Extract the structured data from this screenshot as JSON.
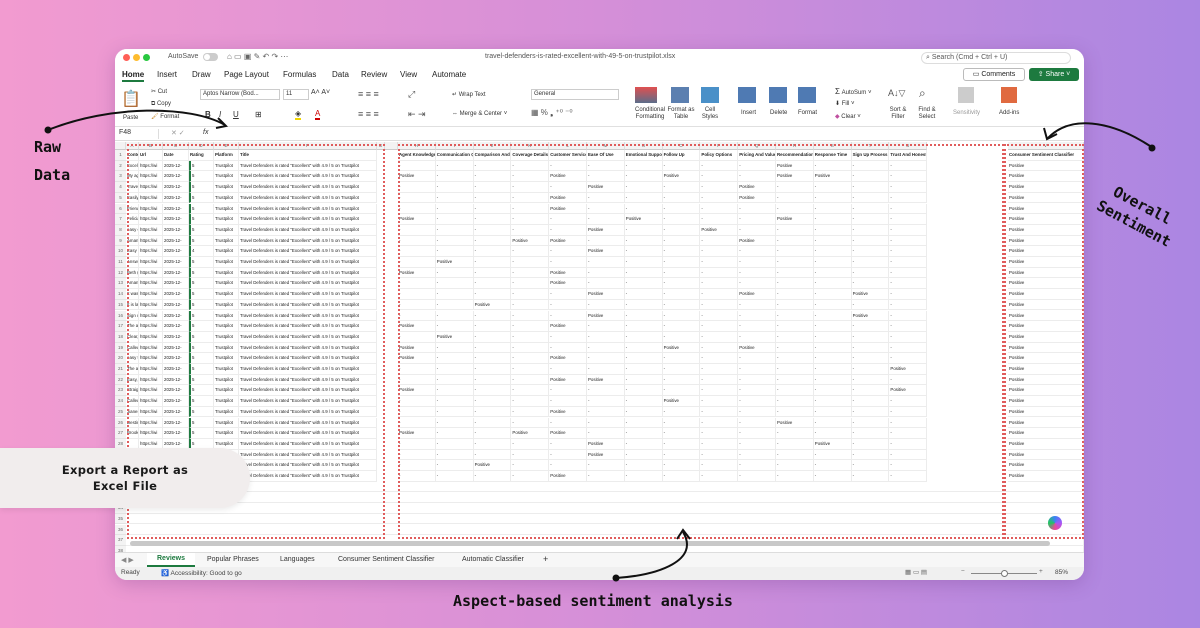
{
  "window": {
    "autosave_label": "AutoSave",
    "filename": "travel-defenders-is-rated-excellent-with-49-5-on-trustpilot.xlsx",
    "search_placeholder": "Search (Cmd + Ctrl + U)"
  },
  "menu": {
    "tabs": [
      "Home",
      "Insert",
      "Draw",
      "Page Layout",
      "Formulas",
      "Data",
      "Review",
      "View",
      "Automate"
    ],
    "comments_label": "Comments",
    "share_label": "Share"
  },
  "ribbon": {
    "paste": "Paste",
    "cut": "Cut",
    "copy": "Copy",
    "format": "Format",
    "font_name": "Aptos Narrow (Bod...",
    "font_size": "11",
    "wrap_text": "Wrap Text",
    "merge_center": "Merge & Center",
    "number_format": "General",
    "conditional_formatting": "Conditional Formatting",
    "format_as_table": "Format as Table",
    "cell_styles": "Cell Styles",
    "insert": "Insert",
    "delete": "Delete",
    "format_cells": "Format",
    "autosum": "AutoSum",
    "fill": "Fill",
    "clear": "Clear",
    "sort_filter": "Sort & Filter",
    "find_select": "Find & Select",
    "sensitivity": "Sensitivity",
    "addins": "Add-ins"
  },
  "formula_bar": {
    "cell_ref": "F48",
    "fx": "fx"
  },
  "grid": {
    "col_letters": [
      "A",
      "B",
      "C",
      "D",
      "E",
      "F",
      "G",
      "H",
      "I",
      "J",
      "K",
      "L",
      "M",
      "N",
      "O",
      "P",
      "Q",
      "R",
      "S",
      "T",
      "U",
      "V"
    ],
    "headers_left": [
      "Content",
      "Url",
      "Date",
      "Rating",
      "Platform",
      "Title"
    ],
    "headers_aspect": [
      "Agent Knowledge",
      "Communication Quality",
      "Comparison And Clarity",
      "Coverage Details",
      "Customer Service",
      "Ease Of Use",
      "Emotional Support",
      "Follow Up",
      "Policy Options",
      "Pricing And Value",
      "Recommendation",
      "Response Time",
      "Sign Up Process",
      "Trust And Honesty"
    ],
    "header_overall": "Consumer Sentiment Classifier",
    "content_snippets": [
      "Excellent",
      "My agent v",
      "Travel Def",
      "Easily fou",
      "Friendly h",
      "Felicia wa",
      "easy comp",
      "Amanda w",
      "Easy and",
      "Answered",
      "Beth (and",
      "Amanda w",
      "It was eas",
      "It is laid o",
      "Sign up c",
      "The agent",
      "Clear, con",
      "Called to l",
      "easy to d",
      "The agent",
      "Easy, free",
      "Straight fo",
      "Called me",
      "Jianessa v",
      "Destiny w",
      "Brooke w",
      "",
      "",
      ""
    ],
    "url_snippet": "https://wi",
    "date_snippet": "2025-12-",
    "rating": "5",
    "rating_alt": "4",
    "platform": "Trustpilot",
    "title_text": "Travel Defenders is rated \"Excellent\" with 4.9 / 5 on Trustpilot",
    "positive": "Positive",
    "dash": "-",
    "aspect_rows": [
      [
        0,
        0,
        0,
        0,
        0,
        0,
        0,
        0,
        0,
        0,
        1,
        0,
        0,
        0
      ],
      [
        1,
        0,
        0,
        0,
        1,
        0,
        0,
        1,
        0,
        0,
        1,
        1,
        0,
        0
      ],
      [
        0,
        0,
        0,
        0,
        0,
        1,
        0,
        0,
        0,
        1,
        0,
        0,
        0,
        0
      ],
      [
        0,
        0,
        0,
        0,
        1,
        0,
        0,
        0,
        0,
        1,
        0,
        0,
        0,
        0
      ],
      [
        0,
        0,
        0,
        0,
        1,
        0,
        0,
        0,
        0,
        0,
        0,
        0,
        0,
        0
      ],
      [
        1,
        0,
        0,
        0,
        0,
        0,
        1,
        0,
        0,
        0,
        1,
        0,
        0,
        0
      ],
      [
        0,
        0,
        0,
        0,
        0,
        1,
        0,
        0,
        1,
        0,
        0,
        0,
        0,
        0
      ],
      [
        0,
        0,
        0,
        1,
        1,
        0,
        0,
        0,
        0,
        1,
        0,
        0,
        0,
        0
      ],
      [
        0,
        0,
        0,
        0,
        0,
        1,
        0,
        0,
        0,
        0,
        0,
        0,
        0,
        0
      ],
      [
        0,
        1,
        0,
        0,
        0,
        0,
        0,
        0,
        0,
        0,
        0,
        0,
        0,
        0
      ],
      [
        1,
        0,
        0,
        0,
        1,
        0,
        0,
        0,
        0,
        0,
        0,
        0,
        0,
        0
      ],
      [
        0,
        0,
        0,
        0,
        1,
        0,
        0,
        0,
        0,
        0,
        0,
        0,
        0,
        0
      ],
      [
        0,
        0,
        0,
        0,
        0,
        1,
        0,
        0,
        0,
        1,
        0,
        0,
        1,
        0
      ],
      [
        0,
        0,
        1,
        0,
        0,
        0,
        0,
        0,
        0,
        0,
        0,
        0,
        0,
        0
      ],
      [
        0,
        0,
        0,
        0,
        0,
        1,
        0,
        0,
        0,
        0,
        0,
        0,
        1,
        0
      ],
      [
        1,
        0,
        0,
        0,
        1,
        0,
        0,
        0,
        0,
        0,
        0,
        0,
        0,
        0
      ],
      [
        0,
        1,
        0,
        0,
        0,
        0,
        0,
        0,
        0,
        0,
        0,
        0,
        0,
        0
      ],
      [
        1,
        0,
        0,
        0,
        0,
        0,
        0,
        1,
        0,
        1,
        0,
        0,
        0,
        0
      ],
      [
        1,
        0,
        0,
        0,
        1,
        0,
        0,
        0,
        0,
        0,
        0,
        0,
        0,
        0
      ],
      [
        0,
        0,
        0,
        0,
        0,
        0,
        0,
        0,
        0,
        0,
        0,
        0,
        0,
        1
      ],
      [
        0,
        0,
        0,
        0,
        1,
        1,
        0,
        0,
        0,
        0,
        0,
        0,
        0,
        0
      ],
      [
        1,
        0,
        0,
        0,
        0,
        0,
        0,
        0,
        0,
        0,
        0,
        0,
        0,
        1
      ],
      [
        0,
        0,
        0,
        0,
        0,
        0,
        0,
        1,
        0,
        0,
        0,
        0,
        0,
        0
      ],
      [
        0,
        0,
        0,
        0,
        1,
        0,
        0,
        0,
        0,
        0,
        0,
        0,
        0,
        0
      ],
      [
        0,
        0,
        0,
        0,
        0,
        0,
        0,
        0,
        0,
        0,
        1,
        0,
        0,
        0
      ],
      [
        1,
        0,
        0,
        1,
        1,
        0,
        0,
        0,
        0,
        0,
        0,
        0,
        0,
        0
      ],
      [
        0,
        0,
        0,
        0,
        0,
        1,
        0,
        0,
        0,
        0,
        0,
        1,
        0,
        0
      ],
      [
        0,
        0,
        0,
        0,
        0,
        1,
        0,
        0,
        0,
        0,
        0,
        0,
        0,
        0
      ],
      [
        0,
        0,
        1,
        0,
        0,
        0,
        0,
        0,
        0,
        0,
        0,
        0,
        0,
        0
      ],
      [
        0,
        0,
        0,
        0,
        1,
        0,
        0,
        0,
        0,
        0,
        0,
        0,
        0,
        0
      ]
    ],
    "row_count": 38
  },
  "sheet_tabs": [
    "Reviews",
    "Popular Phrases",
    "Languages",
    "Consumer Sentiment Classifier",
    "Automatic Classifier"
  ],
  "status": {
    "ready": "Ready",
    "accessibility": "Accessibility: Good to go",
    "zoom": "85%"
  },
  "annotations": {
    "raw_data": [
      "Raw",
      "Data"
    ],
    "overall_sentiment": [
      "Overall",
      "Sentiment"
    ],
    "aspect_based": "Aspect-based sentiment analysis",
    "export_report": [
      "Export a Report as",
      "Excel File"
    ]
  },
  "colors": {
    "accent_green": "#1d7a3f",
    "dashed_border": "#e05c5c"
  }
}
